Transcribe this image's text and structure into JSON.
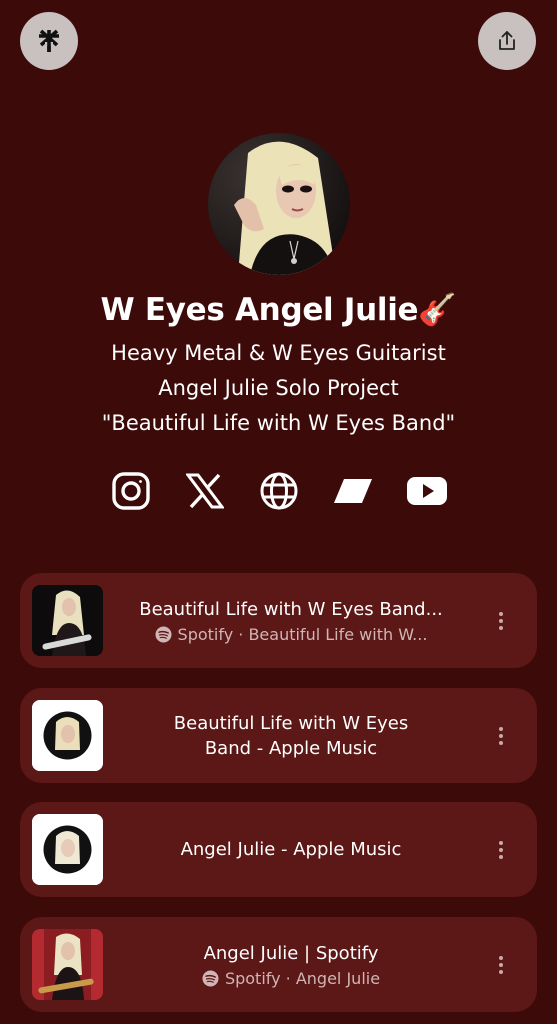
{
  "header": {
    "logo_icon": "linktree-asterisk-icon",
    "share_icon": "share-icon"
  },
  "profile": {
    "name": "W Eyes Angel Julie🎸",
    "bio": [
      "Heavy Metal & W Eyes Guitarist",
      "Angel Julie Solo Project",
      "\"Beautiful Life with W Eyes Band\""
    ]
  },
  "socials": [
    {
      "name": "instagram-icon"
    },
    {
      "name": "x-icon"
    },
    {
      "name": "globe-icon"
    },
    {
      "name": "parallelogram-icon"
    },
    {
      "name": "youtube-icon"
    }
  ],
  "links": [
    {
      "title": "Beautiful Life with W Eyes Band...",
      "sub_icon": "spotify-icon",
      "subtitle": "Spotify · Beautiful Life with W...",
      "thumb": "dark-photo"
    },
    {
      "title": "Beautiful Life with W Eyes Band - Apple Music",
      "thumb": "circle-photo"
    },
    {
      "title": "Angel Julie - Apple Music",
      "thumb": "circle-photo"
    },
    {
      "title": "Angel Julie | Spotify",
      "sub_icon": "spotify-icon",
      "subtitle": "Spotify · Angel Julie",
      "thumb": "red-photo"
    }
  ],
  "colors": {
    "background": "#3d0a0a",
    "card": "#5c1717",
    "button": "#c9c0c0"
  }
}
